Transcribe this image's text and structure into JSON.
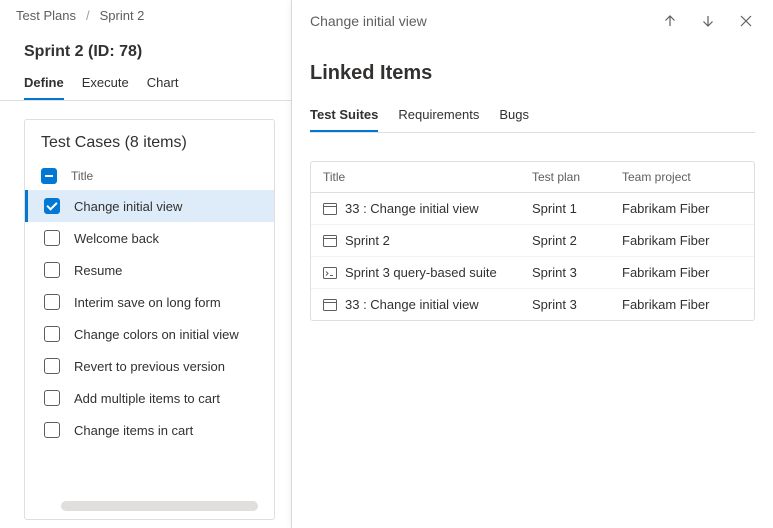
{
  "breadcrumb": [
    "Test Plans",
    "Sprint 2"
  ],
  "page_title": "Sprint 2 (ID: 78)",
  "main_tabs": [
    {
      "label": "Define",
      "active": true
    },
    {
      "label": "Execute",
      "active": false
    },
    {
      "label": "Chart",
      "active": false
    }
  ],
  "test_cases": {
    "header": "Test Cases (8 items)",
    "column_title": "Title",
    "items": [
      {
        "label": "Change initial view",
        "checked": true,
        "selected": true
      },
      {
        "label": "Welcome back",
        "checked": false,
        "selected": false
      },
      {
        "label": "Resume",
        "checked": false,
        "selected": false
      },
      {
        "label": "Interim save on long form",
        "checked": false,
        "selected": false
      },
      {
        "label": "Change colors on initial view",
        "checked": false,
        "selected": false
      },
      {
        "label": "Revert to previous version",
        "checked": false,
        "selected": false
      },
      {
        "label": "Add multiple items to cart",
        "checked": false,
        "selected": false
      },
      {
        "label": "Change items in cart",
        "checked": false,
        "selected": false
      }
    ]
  },
  "detail": {
    "title": "Change initial view",
    "section_title": "Linked Items",
    "tabs": [
      {
        "label": "Test Suites",
        "active": true
      },
      {
        "label": "Requirements",
        "active": false
      },
      {
        "label": "Bugs",
        "active": false
      }
    ],
    "columns": {
      "title": "Title",
      "plan": "Test plan",
      "project": "Team project"
    },
    "rows": [
      {
        "icon": "static",
        "title": "33 : Change initial view",
        "plan": "Sprint 1",
        "project": "Fabrikam Fiber"
      },
      {
        "icon": "static",
        "title": "Sprint 2",
        "plan": "Sprint 2",
        "project": "Fabrikam Fiber"
      },
      {
        "icon": "query",
        "title": "Sprint 3 query-based suite",
        "plan": "Sprint 3",
        "project": "Fabrikam Fiber"
      },
      {
        "icon": "static",
        "title": "33 : Change initial view",
        "plan": "Sprint 3",
        "project": "Fabrikam Fiber"
      }
    ]
  }
}
